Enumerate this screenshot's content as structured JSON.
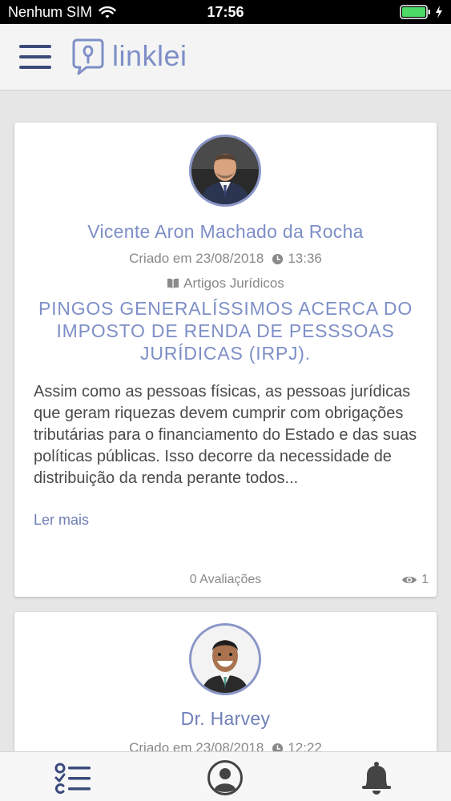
{
  "status_bar": {
    "carrier": "Nenhum SIM",
    "time": "17:56"
  },
  "header": {
    "menu_icon": "hamburger-icon",
    "logo_text": "linklei",
    "brand_color": "#7e8fc7"
  },
  "posts": [
    {
      "author": "Vicente Aron Machado da Rocha",
      "created": "Criado em 23/08/2018",
      "time": "13:36",
      "category": "Artigos Jurídicos",
      "title": "PINGOS GENERALÍSSIMOS ACERCA DO IMPOSTO DE RENDA DE PESSSOAS JURÍDICAS (IRPJ).",
      "excerpt": "Assim como as pessoas físicas, as pessoas jurídicas que geram riquezas devem cumprir com obrigações tributárias para o financiamento do Estado e das suas políticas públicas. Isso decorre da necessidade de distribuição da renda perante todos...",
      "read_more": "Ler mais",
      "ratings": "0 Avaliações",
      "views": "1"
    },
    {
      "author": "Dr. Harvey",
      "created": "Criado em 23/08/2018",
      "time": "12:22"
    }
  ],
  "tab_bar": {
    "items": [
      "feed-list-icon",
      "profile-icon",
      "notification-bell-icon"
    ]
  }
}
